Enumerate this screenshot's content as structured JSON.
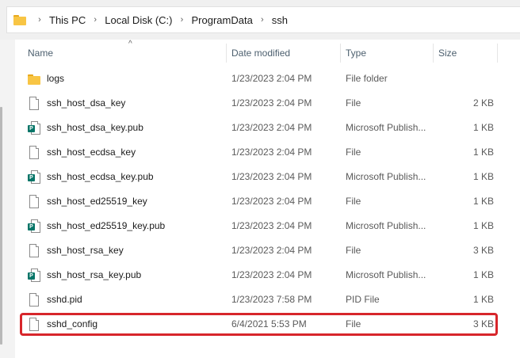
{
  "breadcrumb": [
    {
      "label": "This PC"
    },
    {
      "label": "Local Disk (C:)"
    },
    {
      "label": "ProgramData"
    },
    {
      "label": "ssh"
    }
  ],
  "columns": {
    "name": "Name",
    "date": "Date modified",
    "type": "Type",
    "size": "Size"
  },
  "sort_indicator": "^",
  "files": [
    {
      "name": "logs",
      "date": "1/23/2023 2:04 PM",
      "type": "File folder",
      "size": "",
      "icon": "folder-icon"
    },
    {
      "name": "ssh_host_dsa_key",
      "date": "1/23/2023 2:04 PM",
      "type": "File",
      "size": "2 KB",
      "icon": "file-icon"
    },
    {
      "name": "ssh_host_dsa_key.pub",
      "date": "1/23/2023 2:04 PM",
      "type": "Microsoft Publish...",
      "size": "1 KB",
      "icon": "publisher-file-icon"
    },
    {
      "name": "ssh_host_ecdsa_key",
      "date": "1/23/2023 2:04 PM",
      "type": "File",
      "size": "1 KB",
      "icon": "file-icon"
    },
    {
      "name": "ssh_host_ecdsa_key.pub",
      "date": "1/23/2023 2:04 PM",
      "type": "Microsoft Publish...",
      "size": "1 KB",
      "icon": "publisher-file-icon"
    },
    {
      "name": "ssh_host_ed25519_key",
      "date": "1/23/2023 2:04 PM",
      "type": "File",
      "size": "1 KB",
      "icon": "file-icon"
    },
    {
      "name": "ssh_host_ed25519_key.pub",
      "date": "1/23/2023 2:04 PM",
      "type": "Microsoft Publish...",
      "size": "1 KB",
      "icon": "publisher-file-icon"
    },
    {
      "name": "ssh_host_rsa_key",
      "date": "1/23/2023 2:04 PM",
      "type": "File",
      "size": "3 KB",
      "icon": "file-icon"
    },
    {
      "name": "ssh_host_rsa_key.pub",
      "date": "1/23/2023 2:04 PM",
      "type": "Microsoft Publish...",
      "size": "1 KB",
      "icon": "publisher-file-icon"
    },
    {
      "name": "sshd.pid",
      "date": "1/23/2023 7:58 PM",
      "type": "PID File",
      "size": "1 KB",
      "icon": "file-icon"
    },
    {
      "name": "sshd_config",
      "date": "6/4/2021 5:53 PM",
      "type": "File",
      "size": "3 KB",
      "icon": "file-icon"
    }
  ],
  "highlight_color": "#d7262b",
  "folder_color": "#f8c544",
  "publisher_badge_letter": "P"
}
